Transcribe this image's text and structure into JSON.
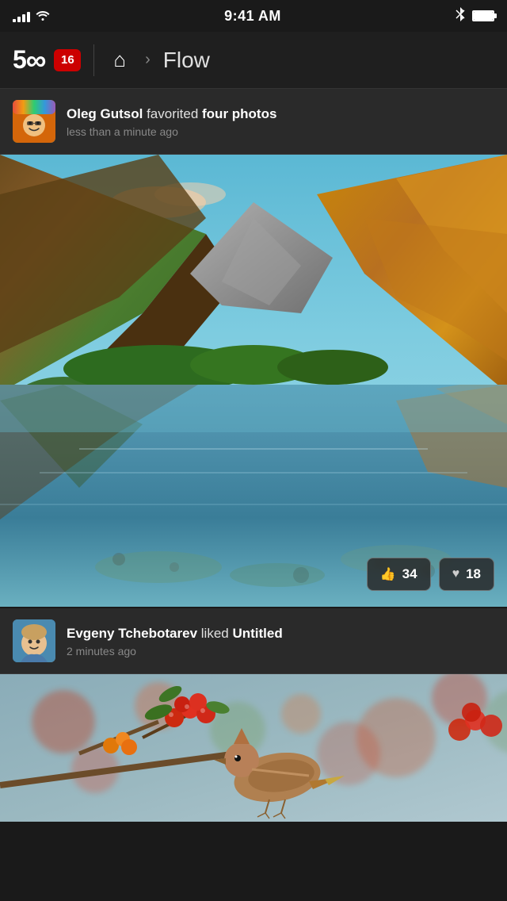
{
  "status": {
    "time": "9:41 AM",
    "signal_bars": [
      3,
      5,
      7,
      10,
      13
    ],
    "battery_level": "full"
  },
  "nav": {
    "logo": "500",
    "notification_count": "16",
    "home_label": "Home",
    "breadcrumb_separator": "›",
    "page_title": "Flow"
  },
  "activity_1": {
    "username": "Oleg Gutsol",
    "action": "favorited",
    "target": "four photos",
    "timestamp": "less than a minute ago"
  },
  "photo_1": {
    "like_count": "34",
    "favorite_count": "18",
    "alt": "Mountain lake landscape"
  },
  "activity_2": {
    "username": "Evgeny Tchebotarev",
    "action": "liked",
    "target": "Untitled",
    "timestamp": "2 minutes ago"
  },
  "photo_2": {
    "alt": "Bird with berries"
  },
  "buttons": {
    "like_icon": "👍",
    "heart_icon": "♥"
  }
}
